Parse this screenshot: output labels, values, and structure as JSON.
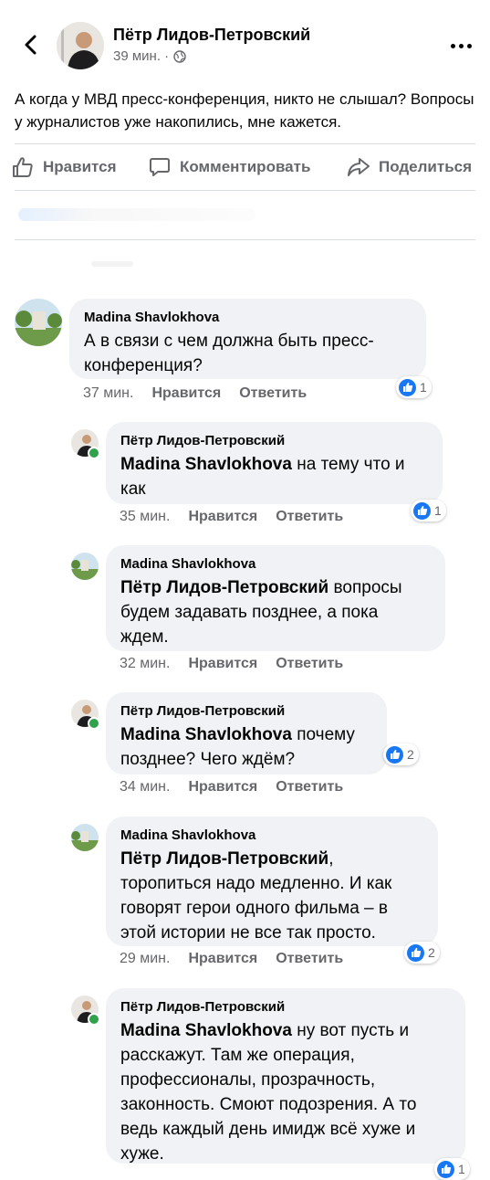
{
  "post": {
    "author": "Пётр Лидов-Петровский",
    "time": "39 мин. ·",
    "text": "А когда у МВД пресс-конференция, никто не слышал? Вопросы у журналистов уже накопились, мне кажется."
  },
  "actions": {
    "like": "Нравится",
    "comment": "Комментировать",
    "share": "Поделиться"
  },
  "icons": {
    "back": "chevron-left-icon",
    "more": "more-horizontal-icon",
    "privacy": "globe-icon",
    "like": "thumbs-up-icon",
    "comment": "comment-icon",
    "share": "share-icon",
    "reaction": "like-reaction-icon"
  },
  "colors": {
    "accent": "#1877f2",
    "bubble": "#f0f2f5",
    "meta": "#65676b",
    "online": "#31a24c"
  },
  "comments": [
    {
      "author": "Madina Shavlokhova",
      "tag": "",
      "text": "А в связи с чем должна быть пресс-конференция?",
      "time": "37 мин.",
      "like": "Нравится",
      "reply": "Ответить",
      "reactions": "1"
    },
    {
      "author": "Пётр Лидов-Петровский",
      "tag": "Madina Shavlokhova",
      "text": " на тему что и как",
      "time": "35 мин.",
      "like": "Нравится",
      "reply": "Ответить",
      "reactions": "1"
    },
    {
      "author": "Madina Shavlokhova",
      "tag": "Пётр Лидов-Петровский",
      "text": " вопросы будем задавать позднее, а пока ждем.",
      "time": "32 мин.",
      "like": "Нравится",
      "reply": "Ответить",
      "reactions": ""
    },
    {
      "author": "Пётр Лидов-Петровский",
      "tag": "Madina Shavlokhova",
      "text": " почему позднее? Чего ждём?",
      "time": "34 мин.",
      "like": "Нравится",
      "reply": "Ответить",
      "reactions": "2"
    },
    {
      "author": "Madina Shavlokhova",
      "tag": "Пётр Лидов-Петровский",
      "text": ", торопиться надо медленно. И как говорят герои  одного фильма – в этой истории не все так просто.",
      "time": "29 мин.",
      "like": "Нравится",
      "reply": "Ответить",
      "reactions": "2"
    },
    {
      "author": "Пётр Лидов-Петровский",
      "tag": "Madina Shavlokhova",
      "text": " ну вот пусть и расскажут. Там же операция, профессионалы, прозрачность, законность. Смоют подозрения. А то ведь каждый день имидж всё хуже и хуже.",
      "time": "",
      "like": "",
      "reply": "",
      "reactions": "1"
    }
  ]
}
